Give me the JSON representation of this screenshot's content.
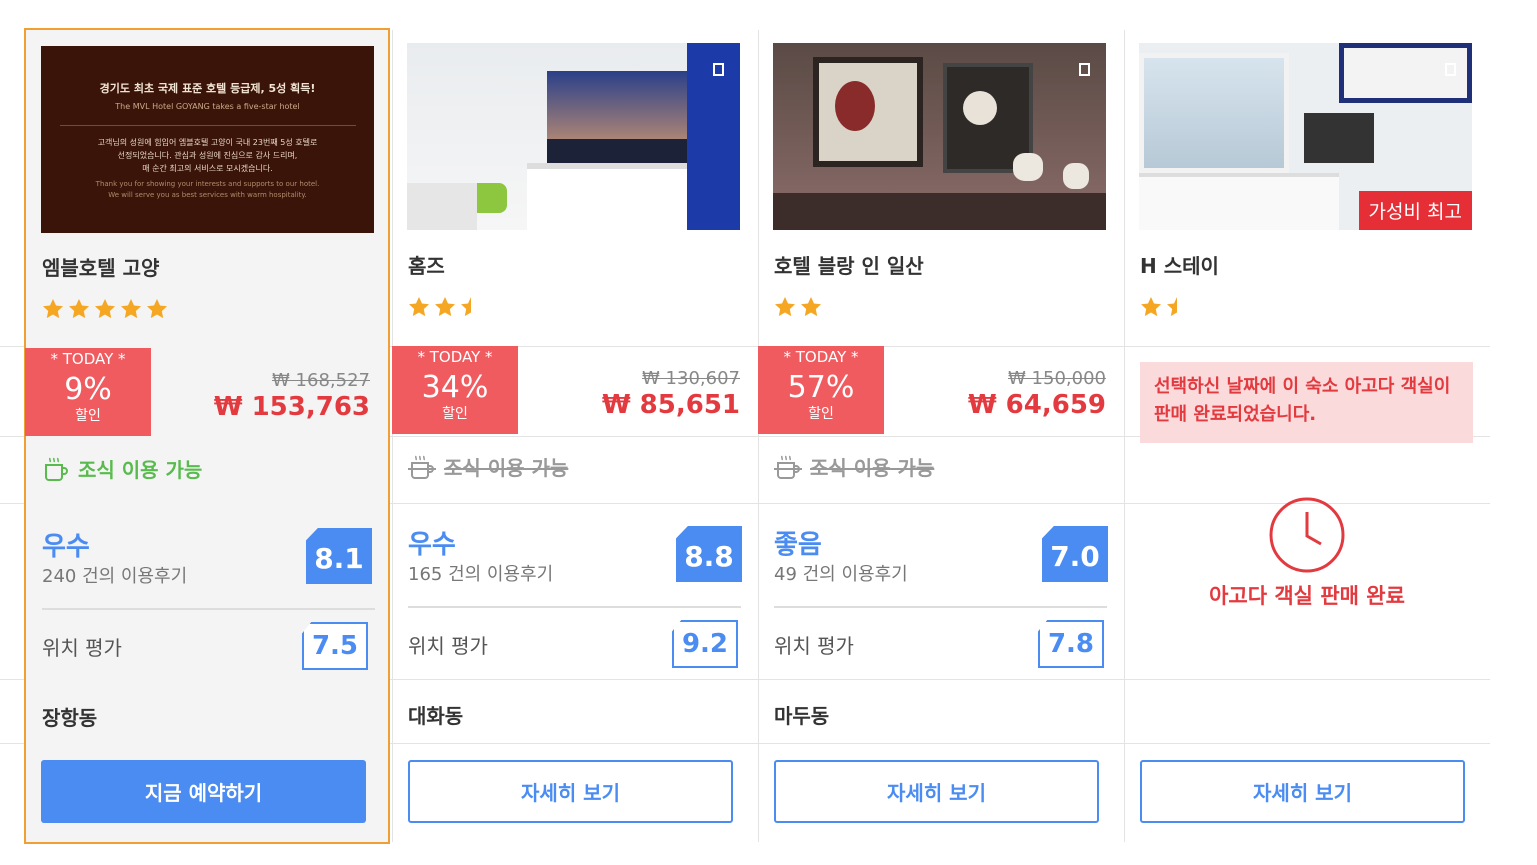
{
  "hotels": [
    {
      "name": "엠블호텔 고양",
      "stars": 5,
      "today_label": "* TODAY *",
      "discount": "9%",
      "discount_unit": "할인",
      "original_price": "₩ 168,527",
      "price": "₩ 153,763",
      "breakfast": "조식 이용 가능",
      "breakfast_available": true,
      "grade": "우수",
      "reviews": "240 건의 이용후기",
      "score": "8.1",
      "location_label": "위치 평가",
      "location_score": "7.5",
      "area": "장항동",
      "button": "지금 예약하기",
      "photo_text": {
        "line1": "경기도 최초 국제 표준 호텔 등급제, 5성 획득!",
        "line2": "The MVL Hotel GOYANG takes a five-star hotel",
        "line3": "고객님의 성원에 힘입어 엠블호텔 고양이 국내 23번째 5성 호텔로",
        "line4": "선정되었습니다. 관심과 성원에 진심으로 감사 드리며,",
        "line5": "매 순간 최고의 서비스로 모시겠습니다.",
        "line6": "Thank you for showing your interests and supports to our hotel.",
        "line7": "We will serve you as best services with warm hospitality."
      }
    },
    {
      "name": "홈즈",
      "stars": 2.5,
      "today_label": "* TODAY *",
      "discount": "34%",
      "discount_unit": "할인",
      "original_price": "₩ 130,607",
      "price": "₩ 85,651",
      "breakfast": "조식 이용 가능",
      "breakfast_available": false,
      "grade": "우수",
      "reviews": "165 건의 이용후기",
      "score": "8.8",
      "location_label": "위치 평가",
      "location_score": "9.2",
      "area": "대화동",
      "button": "자세히 보기"
    },
    {
      "name": "호텔 블랑 인 일산",
      "stars": 2,
      "today_label": "* TODAY *",
      "discount": "57%",
      "discount_unit": "할인",
      "original_price": "₩ 150,000",
      "price": "₩ 64,659",
      "breakfast": "조식 이용 가능",
      "breakfast_available": false,
      "grade": "좋음",
      "reviews": "49 건의 이용후기",
      "score": "7.0",
      "location_label": "위치 평가",
      "location_score": "7.8",
      "area": "마두동",
      "button": "자세히 보기"
    },
    {
      "name": "H 스테이",
      "stars": 1.5,
      "badge": "가성비 최고",
      "sold_note": "선택하신 날짜에 이 숙소 아고다 객실이 판매 완료되었습니다.",
      "sold_text": "아고다 객실 판매 완료",
      "button": "자세히 보기"
    }
  ],
  "colors": {
    "accent": "#4a8cf2",
    "discount": "#ef5b5f",
    "price": "#e23a3f",
    "breakfast": "#59bb4e",
    "selected_border": "#f0a032",
    "star": "#f5a623"
  }
}
